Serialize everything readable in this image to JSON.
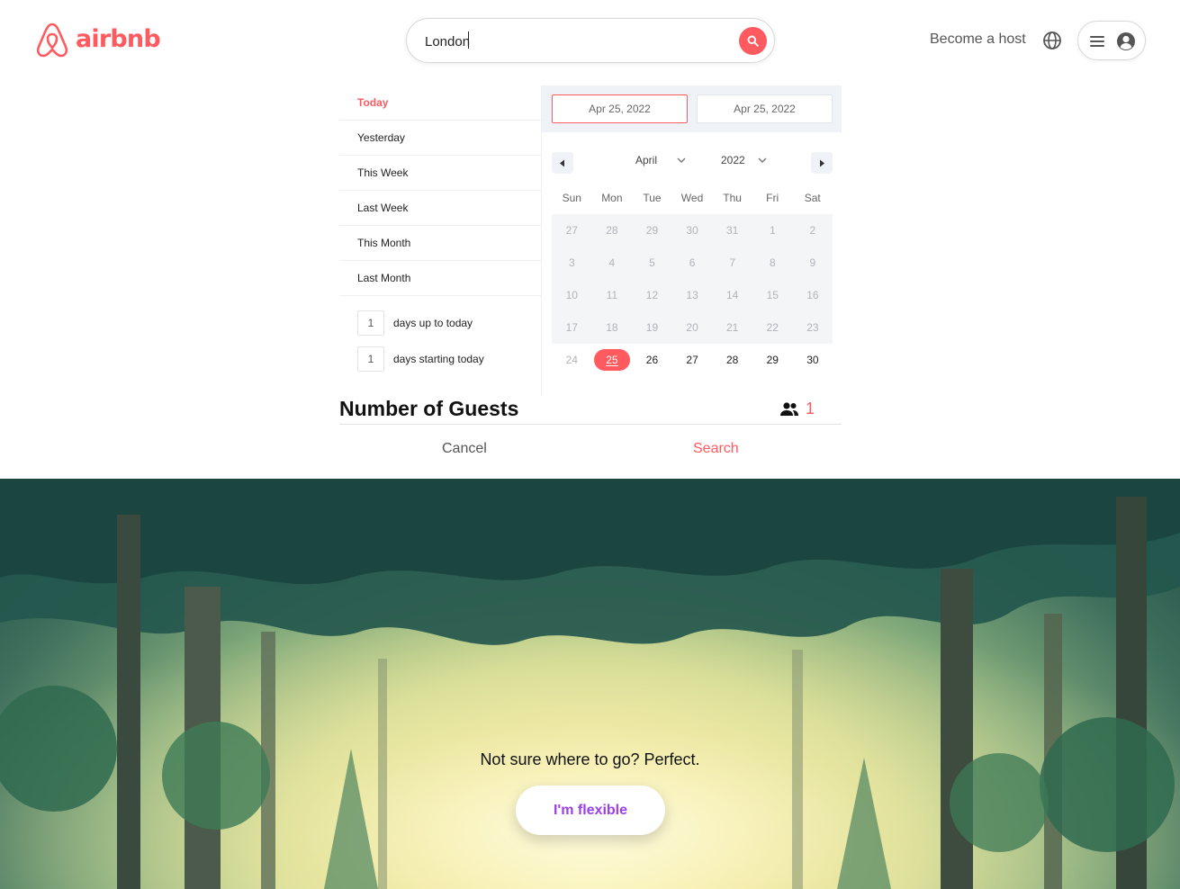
{
  "brand": {
    "name": "airbnb",
    "color": "#ff5a5f"
  },
  "header": {
    "search_value": "London",
    "search_icon": "search-icon",
    "host_link": "Become a host",
    "globe_icon": "globe-icon",
    "menu_icon": "hamburger-menu-icon",
    "avatar_icon": "user-avatar-icon"
  },
  "date_picker": {
    "presets": [
      {
        "label": "Today",
        "active": true
      },
      {
        "label": "Yesterday",
        "active": false
      },
      {
        "label": "This Week",
        "active": false
      },
      {
        "label": "Last Week",
        "active": false
      },
      {
        "label": "This Month",
        "active": false
      },
      {
        "label": "Last Month",
        "active": false
      }
    ],
    "day_ranges": [
      {
        "value": "1",
        "label": "days up to today"
      },
      {
        "value": "1",
        "label": "days starting today"
      }
    ],
    "start_date": "Apr 25, 2022",
    "end_date": "Apr 25, 2022",
    "month": "April",
    "year": "2022",
    "weekdays": [
      "Sun",
      "Mon",
      "Tue",
      "Wed",
      "Thu",
      "Fri",
      "Sat"
    ],
    "weeks": [
      [
        "27",
        "28",
        "29",
        "30",
        "31",
        "1",
        "2"
      ],
      [
        "3",
        "4",
        "5",
        "6",
        "7",
        "8",
        "9"
      ],
      [
        "10",
        "11",
        "12",
        "13",
        "14",
        "15",
        "16"
      ],
      [
        "17",
        "18",
        "19",
        "20",
        "21",
        "22",
        "23"
      ],
      [
        "24",
        "25",
        "26",
        "27",
        "28",
        "29",
        "30"
      ]
    ],
    "selected_day": "25"
  },
  "guests": {
    "title": "Number of Guests",
    "icon": "people-icon",
    "count": "1"
  },
  "actions": {
    "cancel": "Cancel",
    "search": "Search"
  },
  "hero": {
    "tagline": "Not sure where to go? Perfect.",
    "button": "I'm flexible",
    "button_color": "#9b40e6"
  }
}
